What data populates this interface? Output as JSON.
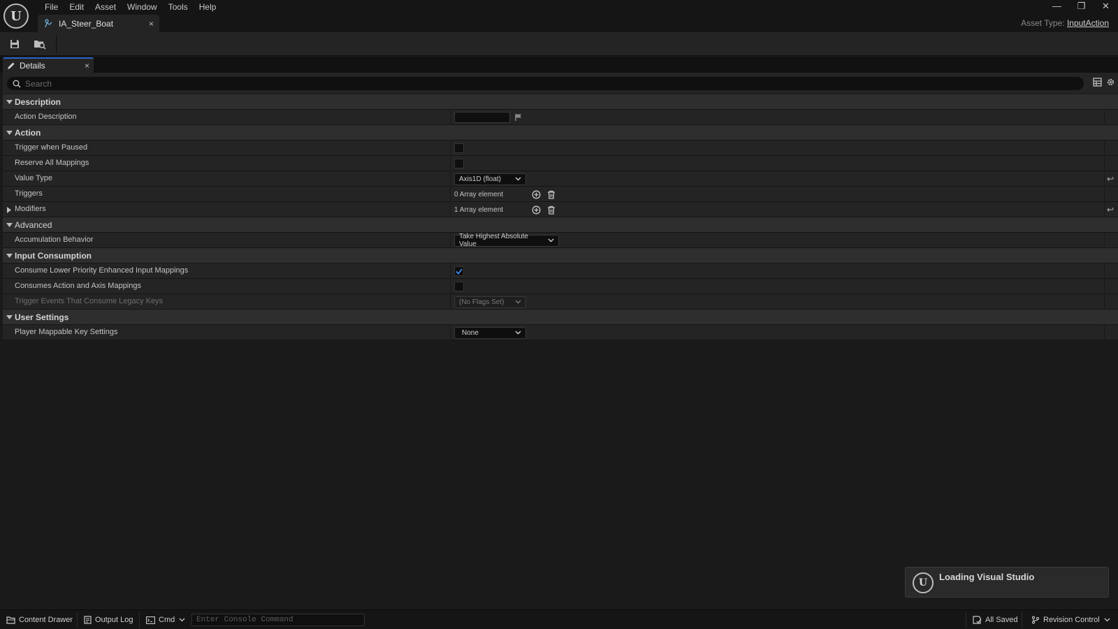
{
  "menu": [
    "File",
    "Edit",
    "Asset",
    "Window",
    "Tools",
    "Help"
  ],
  "asset_tab": {
    "label": "IA_Steer_Boat",
    "close": "×"
  },
  "window_controls": {
    "minimize": "—",
    "restore": "❐",
    "close": "✕"
  },
  "asset_type": {
    "label": "Asset Type:",
    "value": "InputAction"
  },
  "details_tab": {
    "label": "Details",
    "close": "×"
  },
  "search": {
    "placeholder": "Search"
  },
  "sections": {
    "description": {
      "label": "Description",
      "action_description": "Action Description"
    },
    "action": {
      "label": "Action",
      "trigger_when_paused": "Trigger when Paused",
      "reserve_all_mappings": "Reserve All Mappings",
      "value_type": "Value Type",
      "value_type_value": "Axis1D (float)",
      "triggers": "Triggers",
      "triggers_value": "0 Array element",
      "modifiers": "Modifiers",
      "modifiers_value": "1 Array element"
    },
    "advanced": {
      "label": "Advanced",
      "accumulation_behavior": "Accumulation Behavior",
      "accumulation_value": "Take Highest Absolute Value"
    },
    "input_consumption": {
      "label": "Input Consumption",
      "consume_lower": "Consume Lower Priority Enhanced Input Mappings",
      "consumes_action_axis": "Consumes Action and Axis Mappings",
      "trigger_events_legacy": "Trigger Events That Consume Legacy Keys",
      "trigger_events_value": "(No Flags Set)"
    },
    "user_settings": {
      "label": "User Settings",
      "player_mappable": "Player Mappable Key Settings",
      "player_mappable_value": "None"
    }
  },
  "toast": {
    "text": "Loading Visual Studio"
  },
  "statusbar": {
    "content_drawer": "Content Drawer",
    "output_log": "Output Log",
    "cmd": "Cmd",
    "console_placeholder": "Enter Console Command",
    "all_saved": "All Saved",
    "revision_control": "Revision Control"
  },
  "colors": {
    "accent": "#2b66c9",
    "panel": "#242424",
    "category": "#2e2e2e",
    "background": "#1a1a1a"
  }
}
